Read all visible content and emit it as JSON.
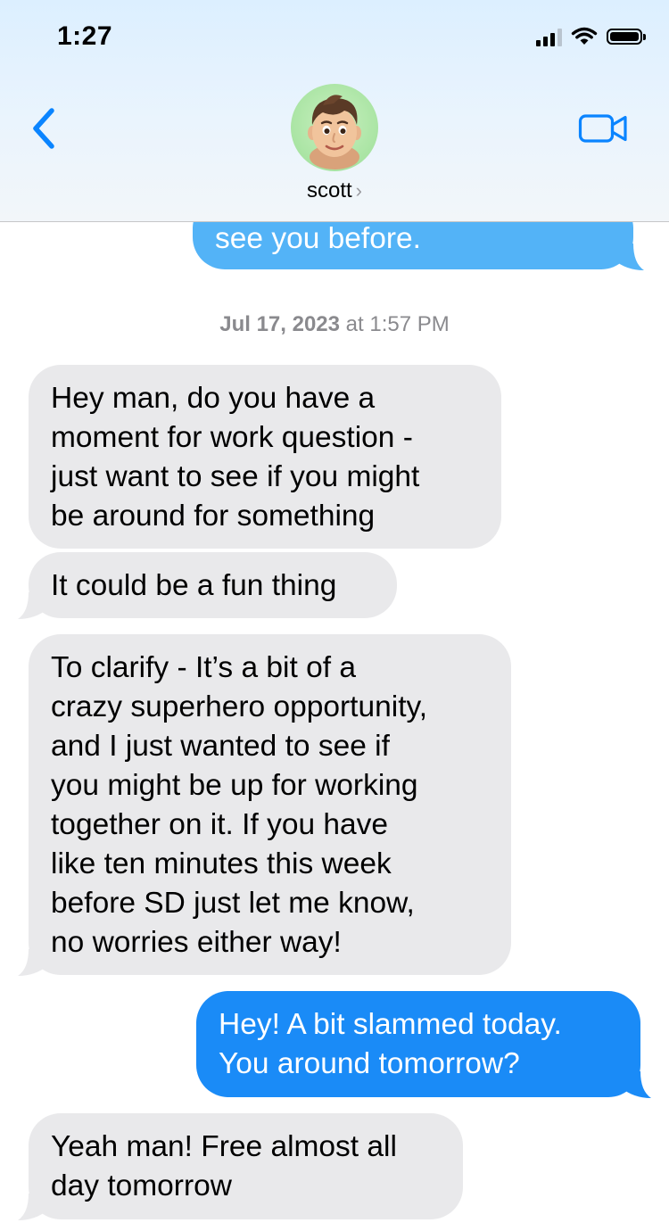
{
  "status_bar": {
    "time": "1:27"
  },
  "header": {
    "contact_name": "scott",
    "chevron": "›",
    "icons": [
      "chevron-left-icon",
      "video-camera-icon"
    ]
  },
  "colors": {
    "sent_bubble": "#1a8bf7",
    "sent_bubble_highlighted": "#53b3f7",
    "received_bubble": "#e9e9eb",
    "accent": "#0a84ff"
  },
  "conversation": {
    "timestamp_date": "Jul 17, 2023",
    "timestamp_at": " at ",
    "timestamp_time": "1:57 PM",
    "messages": [
      {
        "direction": "sent",
        "text": "see you before."
      },
      {
        "direction": "received",
        "text": "Hey man, do you have a\nmoment for work question -\njust want to see if you might\nbe around for something"
      },
      {
        "direction": "received",
        "text": "It could be a fun thing"
      },
      {
        "direction": "received",
        "text": "To clarify - It’s a bit of a\ncrazy superhero opportunity,\nand I just wanted to see if\nyou might be up for working\ntogether on it. If you have\nlike ten minutes this week\nbefore SD just let me know,\nno worries either way!"
      },
      {
        "direction": "sent",
        "text": "Hey! A bit slammed today.\nYou around tomorrow?"
      },
      {
        "direction": "received",
        "text": "Yeah man! Free almost all\nday tomorrow"
      }
    ]
  }
}
